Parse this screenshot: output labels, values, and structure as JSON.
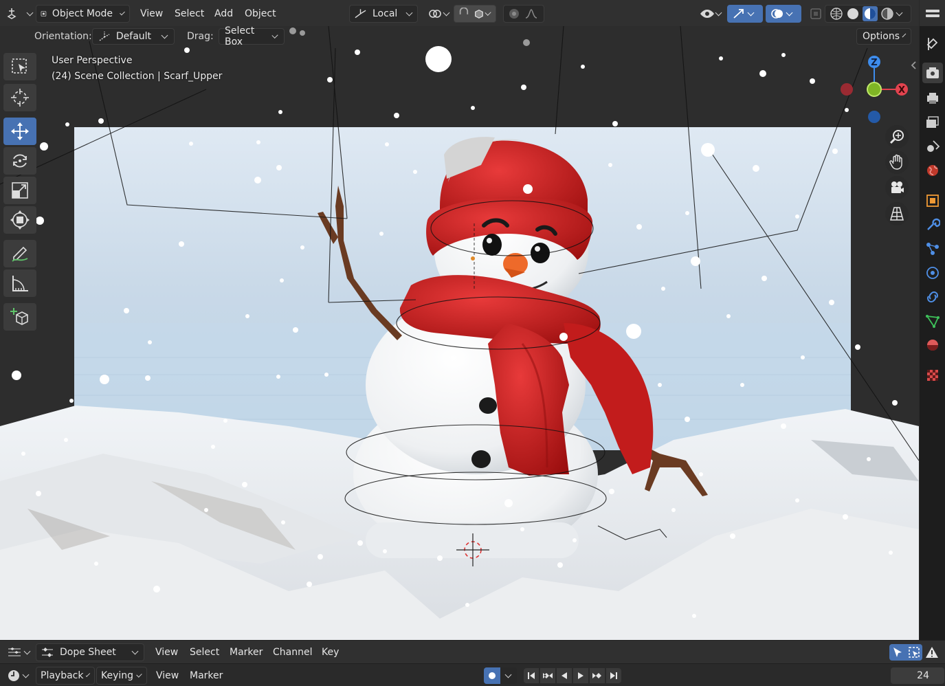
{
  "header": {
    "mode": "Object Mode",
    "menus": [
      "View",
      "Select",
      "Add",
      "Object"
    ],
    "transform_orientation": "Local",
    "options_label": "Options"
  },
  "tool_settings": {
    "orientation_label": "Orientation:",
    "orientation_value": "Default",
    "drag_label": "Drag:",
    "drag_value": "Select Box"
  },
  "viewport": {
    "view_name": "User Perspective",
    "collection_info": "(24) Scene Collection | Scarf_Upper",
    "gizmo_axes": {
      "z": "Z",
      "x": "X"
    }
  },
  "left_toolbar": [
    {
      "name": "select-box",
      "active": false
    },
    {
      "name": "cursor",
      "active": false
    },
    {
      "name": "move",
      "active": true
    },
    {
      "name": "rotate",
      "active": false
    },
    {
      "name": "scale",
      "active": false
    },
    {
      "name": "transform",
      "active": false
    },
    {
      "name": "annotate",
      "active": false
    },
    {
      "name": "measure",
      "active": false
    },
    {
      "name": "add-cube",
      "active": false
    }
  ],
  "dope_sheet": {
    "editor_type": "Dope Sheet",
    "menus": [
      "View",
      "Select",
      "Marker",
      "Channel",
      "Key"
    ]
  },
  "timeline": {
    "menus": [
      "Playback",
      "Keying",
      "View",
      "Marker"
    ],
    "current_frame": "24"
  },
  "colors": {
    "accent": "#4772b3",
    "axis_x": "#e2434f",
    "axis_y": "#8bcb2a",
    "axis_z": "#3e8ded",
    "scarf": "#c81e1e",
    "header": "#303030"
  }
}
